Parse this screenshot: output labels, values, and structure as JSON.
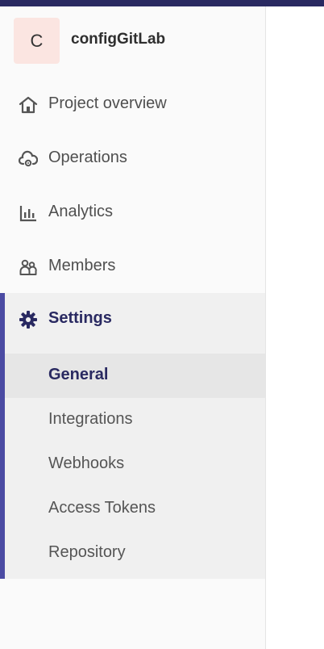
{
  "project": {
    "avatar_letter": "C",
    "name": "configGitLab"
  },
  "nav": {
    "items": [
      {
        "label": "Project overview",
        "icon": "home-icon"
      },
      {
        "label": "Operations",
        "icon": "cloud-gear-icon"
      },
      {
        "label": "Analytics",
        "icon": "bar-chart-icon"
      },
      {
        "label": "Members",
        "icon": "users-icon"
      }
    ],
    "settings": {
      "label": "Settings",
      "icon": "gear-icon",
      "subitems": [
        {
          "label": "General",
          "active": true
        },
        {
          "label": "Integrations"
        },
        {
          "label": "Webhooks"
        },
        {
          "label": "Access Tokens"
        },
        {
          "label": "Repository"
        }
      ]
    }
  },
  "colors": {
    "topbar": "#292961",
    "accent": "#4b4ba3",
    "active_text": "#292961",
    "avatar_bg": "#fbe5e1"
  }
}
